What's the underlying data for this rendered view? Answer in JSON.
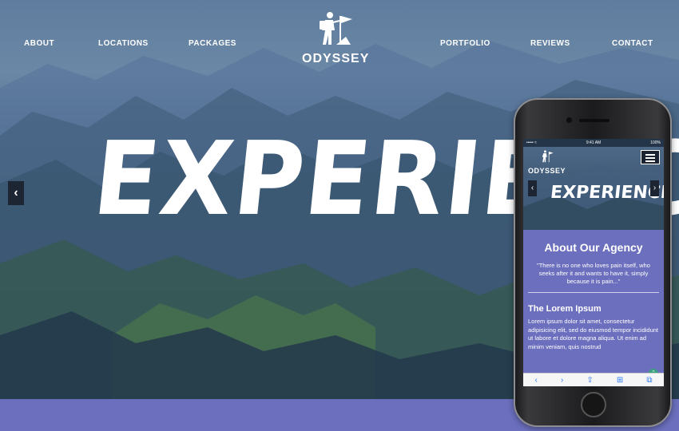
{
  "nav": {
    "left": [
      "ABOUT",
      "LOCATIONS",
      "PACKAGES"
    ],
    "right": [
      "PORTFOLIO",
      "REVIEWS",
      "CONTACT"
    ]
  },
  "logo": {
    "brand": "ODYSSEY",
    "icon": "hiker-flag-icon"
  },
  "hero": {
    "title": "EXPERIENC",
    "prev_arrow": "‹"
  },
  "phone": {
    "status": {
      "carrier": "••••• ≈",
      "time": "9:41 AM",
      "battery": "100%"
    },
    "logo_brand": "ODYSSEY",
    "hero_title": "EXPERIENCE",
    "arrow_left": "‹",
    "arrow_right": "›",
    "agency_title": "About Our Agency",
    "quote": "\"There is no one who loves pain itself, who seeks after it and wants to have it, simply because it is pain...\"",
    "lorem_title": "The Lorem Ipsum",
    "lorem_text": "Lorem ipsum dolor sit amet, consectetur adipisicing elit, sed do eiusmod tempor incididunt ut labore et dolore magna aliqua. Ut enim ad minim veniam, quis nostrud",
    "browser_icons": [
      "back-icon",
      "forward-icon",
      "share-icon",
      "bookmarks-icon",
      "tabs-icon"
    ]
  },
  "colors": {
    "accent": "#6b6fbd",
    "hero_dark": "#27404f",
    "ios_blue": "#2f7bf6",
    "scroll_top": "#3ba37c"
  }
}
